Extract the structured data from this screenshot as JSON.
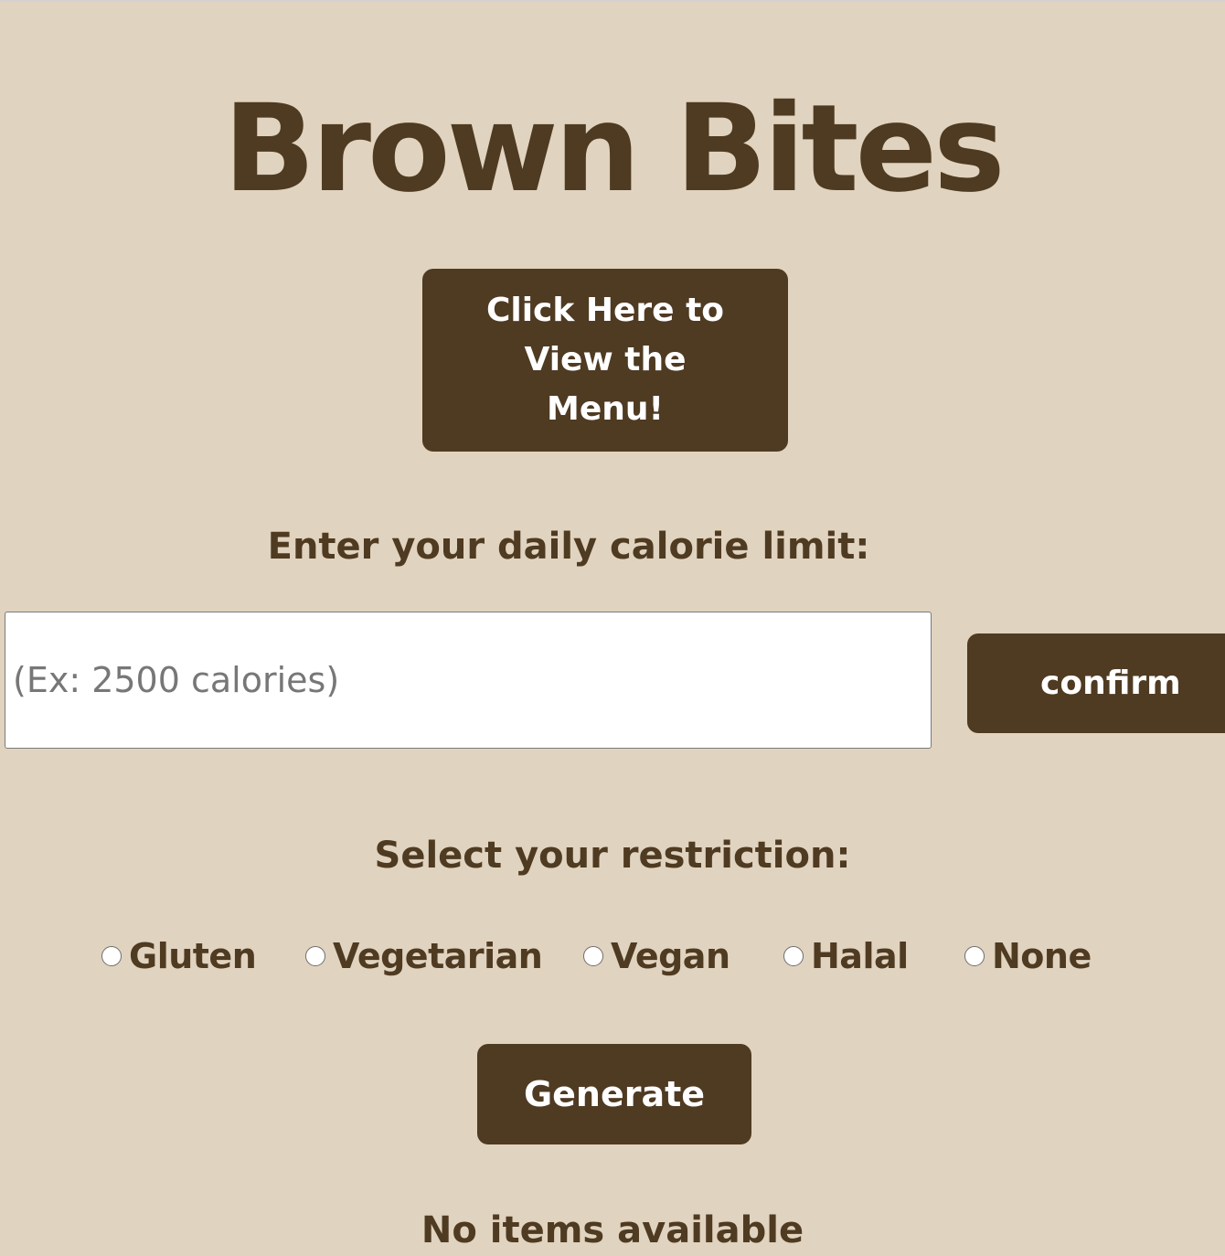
{
  "header": {
    "title": "Brown Bites"
  },
  "menu_button": {
    "label": "Click Here to View the Menu!"
  },
  "calorie": {
    "label": "Enter your daily calorie limit:",
    "placeholder": "(Ex: 2500 calories)",
    "value": "",
    "confirm_label": "confirm"
  },
  "restriction": {
    "label": "Select your restriction:",
    "options": [
      {
        "label": "Gluten",
        "selected": false
      },
      {
        "label": "Vegetarian",
        "selected": false
      },
      {
        "label": "Vegan",
        "selected": false
      },
      {
        "label": "Halal",
        "selected": false
      },
      {
        "label": "None",
        "selected": false
      }
    ]
  },
  "generate_button": {
    "label": "Generate"
  },
  "status": {
    "text": "No items available"
  },
  "colors": {
    "background": "#e0d3bf",
    "brand_brown": "#4f3a22",
    "button_text": "#ffffff"
  }
}
